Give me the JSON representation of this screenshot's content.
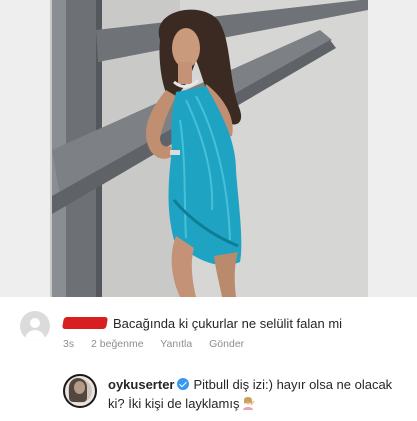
{
  "comment": {
    "text": "Bacağında ki çukurlar ne selülit falan mi",
    "time": "3s",
    "likes": "2 beğenme",
    "reply_label": "Yanıtla",
    "send_label": "Gönder"
  },
  "reply": {
    "username": "oykuserter",
    "text": "Pitbull diş izi:) hayır olsa ne olacak ki? İki kişi de layklamış"
  },
  "colors": {
    "verified": "#3897f0",
    "redaction": "#d81e1e",
    "dress": "#1fa3c2",
    "meta_text": "#8e8e8e"
  }
}
